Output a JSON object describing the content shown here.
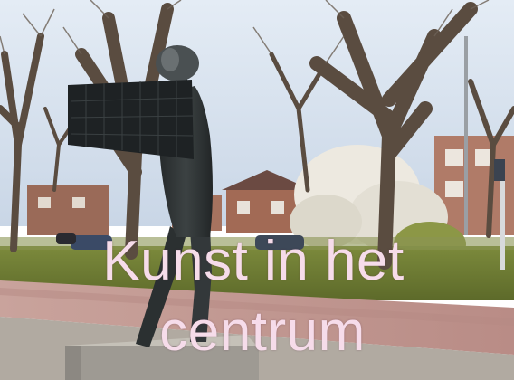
{
  "caption": {
    "line1": "Kunst in het",
    "line2": "centrum",
    "color": "#f6dcea"
  },
  "scene": {
    "sky_color": "#cfdcec",
    "grass_color": "#6f7f32",
    "path_color": "#c79a93",
    "pavement_color": "#b3aba2",
    "sculpture_color": "#2e3334"
  }
}
